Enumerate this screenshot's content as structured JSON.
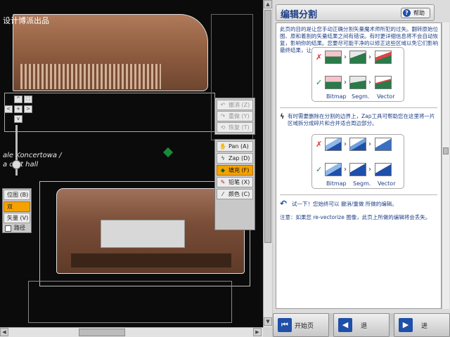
{
  "watermark": "设计博派出品",
  "canvas": {
    "caption_line1": "ale Koncertowa /",
    "caption_line2": "a  cert hall"
  },
  "nav_control": {
    "up": "^",
    "down": "v",
    "left": "<",
    "right": ">",
    "zoom_in": "+",
    "zoom_out": "-",
    "fit": "⛶"
  },
  "edit_palette": {
    "undo": "撤消 (Z)",
    "redo": "重做 (Y)",
    "restore": "恢复 (T)"
  },
  "tool_palette": {
    "pan": "Pan (A)",
    "zap": "Zap (D)",
    "fill": "填充 (F)",
    "pencil": "铅笔 (X)",
    "color": "颜色 (C)"
  },
  "view_palette": {
    "bitmap": "位图 (B)",
    "both": "双",
    "vector": "矢量 (V)",
    "path": "路径"
  },
  "help": {
    "title": "编辑分割",
    "help_button": "帮助",
    "intro": "此页的目的是让您手动正确分割矢量魔术师所犯的过失。翻转原始位图、原和着割的矢量结果之间有错误。有时更详细信息将不会自动恢复，影响你的结果。您要尽可能干净的以修正这些区域以免它们影响最终结果，让您的区域有一条清晰的路径。",
    "demo1_labels": [
      "Bitmap",
      "Segm.",
      "Vector"
    ],
    "zap_text": "有时需要删除在分割的边界上，Zap工具可帮助您在这里将一片区域拆分成碎片和合并适合周边部分。",
    "demo2_labels": [
      "Bitmap",
      "Segm.",
      "Vector"
    ],
    "undo_text": "试一下！您始终可以 撤消/重做 所做的编辑。",
    "note_text": "注意：如果您 re-vectorize 图像，此页上所做的编辑将会丢失。"
  },
  "bottom_nav": {
    "start": "开始页",
    "back": "退",
    "next": "进"
  },
  "colors": {
    "accent": "#f5a200",
    "link_blue": "#1f3f86",
    "icon_blue": "#1f4fa8"
  }
}
